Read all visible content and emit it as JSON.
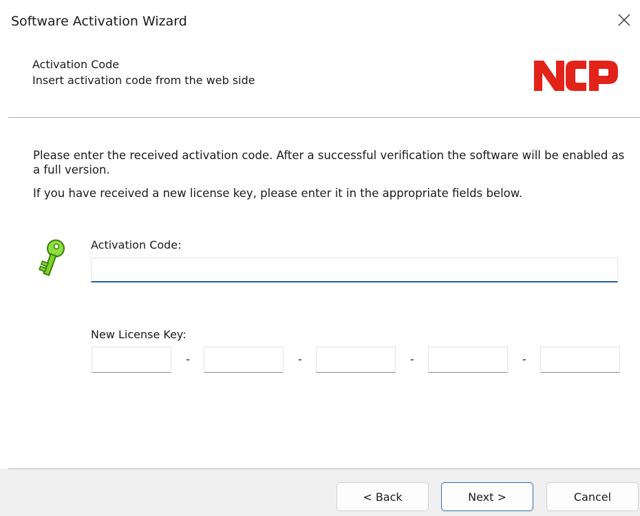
{
  "window": {
    "title": "Software Activation Wizard"
  },
  "header": {
    "title": "Activation Code",
    "subtitle": "Insert activation code from the web side",
    "logo_text": "NCP",
    "logo_color": "#e2231a"
  },
  "body": {
    "description_1": "Please enter the received activation code. After a successful verification the software will be enabled as a full version.",
    "description_2": "If you have received a new license key, please enter it in the appropriate fields below.",
    "activation_code": {
      "label": "Activation Code:",
      "value": ""
    },
    "license_key": {
      "label": "New License Key:",
      "separator": "-",
      "fields": [
        "",
        "",
        "",
        "",
        ""
      ]
    }
  },
  "footer": {
    "back_label": "< Back",
    "next_label": "Next >",
    "cancel_label": "Cancel"
  },
  "icons": {
    "key": "key-icon",
    "close": "close-icon"
  },
  "colors": {
    "accent": "#1f5fa6",
    "key_green": "#7ed321"
  }
}
